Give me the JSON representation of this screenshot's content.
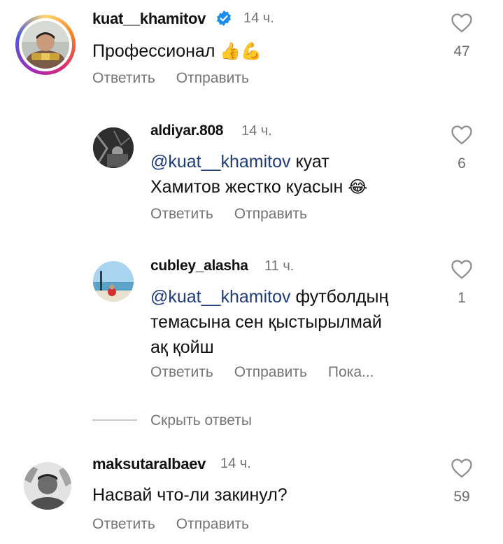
{
  "comments": [
    {
      "username": "kuat__khamitov",
      "verified": true,
      "time": "14 ч.",
      "text": "Профессионал",
      "emoji": "👍💪",
      "likes": "47",
      "actions": [
        "Ответить",
        "Отправить"
      ]
    }
  ],
  "replies": [
    {
      "username": "aldiyar.808",
      "time": "14 ч.",
      "mention": "@kuat__khamitov",
      "text_line1": "куат",
      "text_line2": "Хамитов жестко куасын",
      "emoji": "😂",
      "likes": "6",
      "actions": [
        "Ответить",
        "Отправить"
      ]
    },
    {
      "username": "cubley_alasha",
      "time": "11 ч.",
      "mention": "@kuat__khamitov",
      "text_line1": "футболдың",
      "text_line2": "темасына сен қыстырылмай",
      "text_line3": "ақ қойш",
      "likes": "1",
      "actions": [
        "Ответить",
        "Отправить",
        "Пока..."
      ]
    }
  ],
  "hide_replies_label": "Скрыть ответы",
  "comment2": {
    "username": "maksutaralbaev",
    "time": "14 ч.",
    "text": "Насвай что-ли закинул?",
    "likes": "59",
    "actions": [
      "Ответить",
      "Отправить"
    ]
  },
  "colors": {
    "verified_blue": "#1a8cf0",
    "mention_blue": "#1f3d7a",
    "secondary_text": "#757575"
  }
}
